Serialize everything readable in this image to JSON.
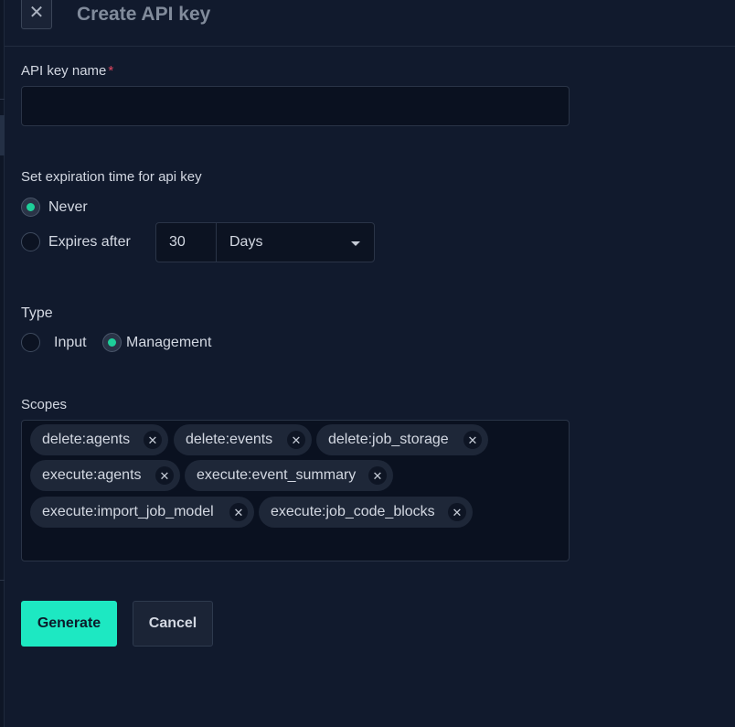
{
  "dialog": {
    "title": "Create API key",
    "close_symbol": "✕"
  },
  "name_field": {
    "label": "API key name",
    "required_mark": "*",
    "value": ""
  },
  "expiration": {
    "label": "Set expiration time for api key",
    "options": [
      {
        "label": "Never",
        "checked": true
      },
      {
        "label": "Expires after",
        "checked": false
      }
    ],
    "amount": "30",
    "unit": "Days"
  },
  "type": {
    "label": "Type",
    "options": [
      {
        "label": "Input",
        "checked": false
      },
      {
        "label": "Management",
        "checked": true
      }
    ]
  },
  "scopes": {
    "label": "Scopes",
    "remove_symbol": "✕",
    "chips": [
      "delete:agents",
      "delete:events",
      "delete:job_storage",
      "execute:agents",
      "execute:event_summary",
      "execute:import_job_model",
      "execute:job_code_blocks"
    ]
  },
  "actions": {
    "generate_label": "Generate",
    "cancel_label": "Cancel"
  },
  "colors": {
    "accent": "#1de8c2",
    "radio_checked": "#1ecf99",
    "required": "#e0455f",
    "background": "#111a2d"
  }
}
